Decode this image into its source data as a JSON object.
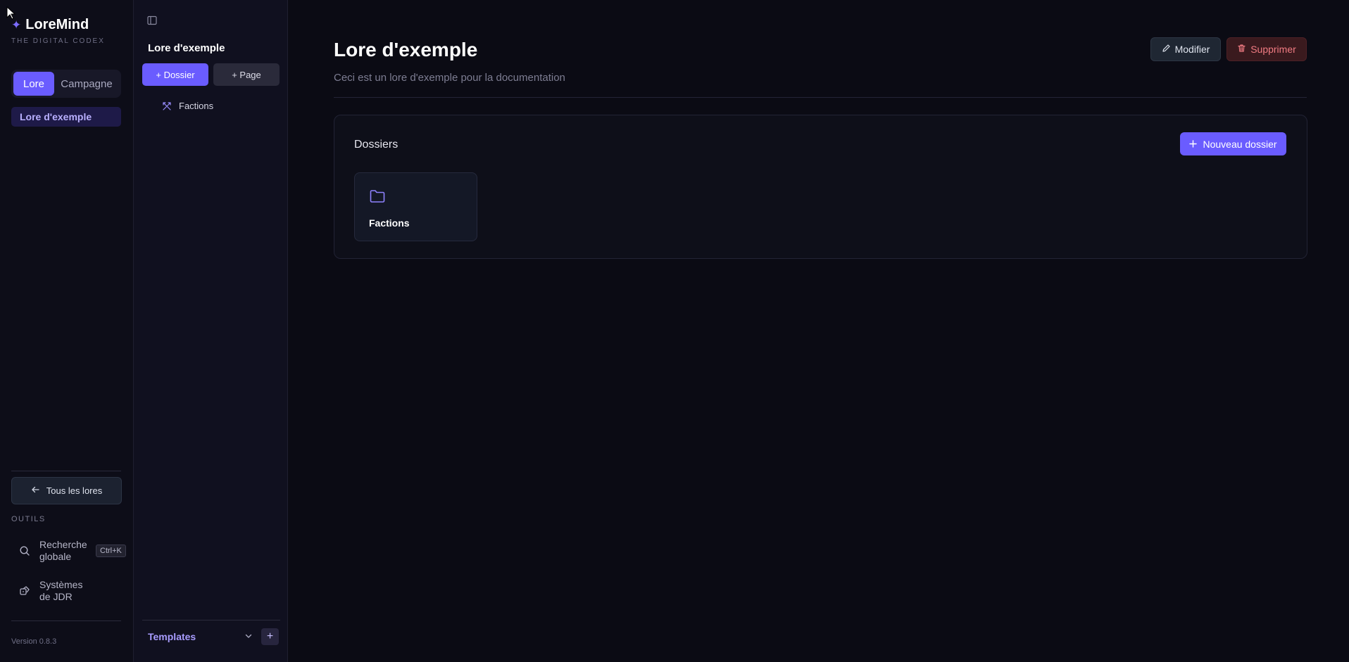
{
  "app": {
    "name": "LoreMind",
    "tagline": "THE DIGITAL CODEX",
    "version": "Version 0.8.3",
    "accent_color": "#6a5cff"
  },
  "nav": {
    "modes": [
      "Lore",
      "Campagne"
    ],
    "active_mode": "Lore",
    "current_lore": "Lore d'exemple",
    "back_label": "Tous les lores",
    "tools_label": "OUTILS",
    "tools": [
      {
        "label": "Recherche globale",
        "shortcut": "Ctrl+K",
        "icon": "search-icon"
      },
      {
        "label": "Systèmes de JDR",
        "icon": "dice-icon"
      }
    ]
  },
  "tree": {
    "title": "Lore d'exemple",
    "add_folder_label": "+ Dossier",
    "add_page_label": "+ Page",
    "items": [
      {
        "label": "Factions",
        "icon": "swords-icon"
      }
    ],
    "templates_label": "Templates",
    "templates_add": "+"
  },
  "main": {
    "title": "Lore d'exemple",
    "description": "Ceci est un lore d'exemple pour la documentation",
    "edit_label": "Modifier",
    "delete_label": "Supprimer",
    "folders_section": {
      "title": "Dossiers",
      "new_label": "Nouveau dossier",
      "folders": [
        {
          "name": "Factions",
          "icon": "folder-icon"
        }
      ]
    }
  }
}
